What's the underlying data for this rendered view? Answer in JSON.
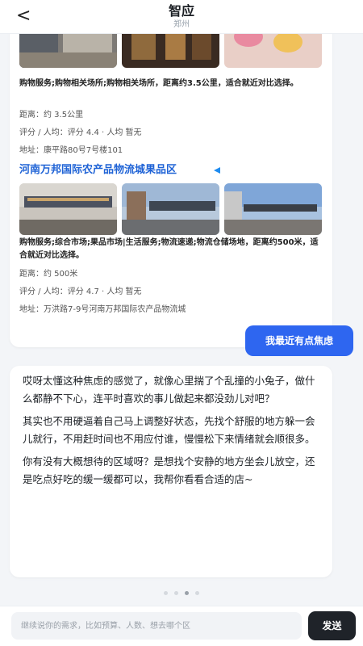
{
  "header": {
    "back_icon": "chevron-left-icon",
    "title": "智应",
    "subtitle": "郑州"
  },
  "poi_prev": {
    "description": "购物服务;购物相关场所;购物相关场所，距离约3.5公里，适合就近对比选择。",
    "distance": "距离：约 3.5公里",
    "rating": "评分 / 人均：评分 4.4 · 人均 暂无",
    "address": "地址：康平路80号7号楼101"
  },
  "poi_wanbang": {
    "name": "河南万邦国际农产品物流城果品区",
    "nav_icon": "navigation-arrow-icon",
    "description": "购物服务;综合市场;果品市场|生活服务;物流速递;物流仓储场地，距离约500米，适合就近对比选择。",
    "distance": "距离：约 500米",
    "rating": "评分 / 人均：评分 4.7 · 人均 暂无",
    "address": "地址：万洪路7-9号河南万邦国际农产品物流城"
  },
  "user_message": "我最近有点焦虑",
  "ai_message": {
    "paragraphs": [
      "哎呀太懂这种焦虑的感觉了，就像心里揣了个乱撞的小兔子，做什么都静不下心，连平时喜欢的事儿做起来都没劲儿对吧？",
      "其实也不用硬逼着自己马上调整好状态，先找个舒服的地方躲一会儿就行，不用赶时间也不用应付谁，慢慢松下来情绪就会顺很多。",
      "你有没有大概想待的区域呀？是想找个安静的地方坐会儿放空，还是吃点好吃的缓一缓都可以，我帮你看看合适的店~"
    ]
  },
  "input": {
    "placeholder": "继续说你的需求，比如预算、人数、想去哪个区",
    "value": ""
  },
  "send_label": "发送",
  "colors": {
    "accent": "#2e66f0",
    "link": "#1f63d6",
    "send_bg": "#1f2329",
    "background": "#f3f5f8"
  }
}
